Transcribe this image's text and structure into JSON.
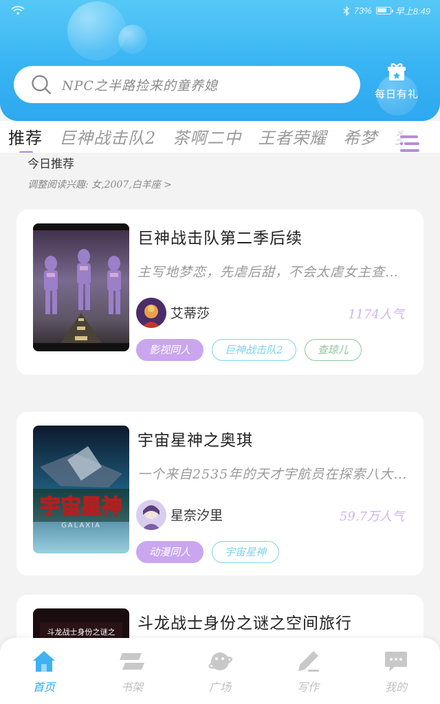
{
  "status_bar": {
    "battery_percent": "73%",
    "time": "早上8:49"
  },
  "search": {
    "placeholder": "NPC之半路捡来的童养媳"
  },
  "daily_gift": {
    "label": "每日有礼",
    "icon": "gift-icon"
  },
  "tabs": [
    {
      "label": "推荐",
      "active": true
    },
    {
      "label": "巨神战击队2",
      "active": false
    },
    {
      "label": "茶啊二中",
      "active": false
    },
    {
      "label": "王者荣耀",
      "active": false
    },
    {
      "label": "希梦",
      "active": false
    },
    {
      "label": "梦",
      "active": false
    }
  ],
  "section": {
    "title": "今日推荐",
    "interest_line": "调整阅读兴趣: 女,2007,白羊座 >"
  },
  "books": [
    {
      "title": "巨神战击队第二季后续",
      "description": "主写地梦恋，先虐后甜，不会太虐女主查…",
      "author": "艾蒂莎",
      "popularity": "1174人气",
      "tags": [
        {
          "label": "影视同人",
          "style": "filled",
          "color": "#c9a6ee"
        },
        {
          "label": "巨神战击队2",
          "style": "outline",
          "color": "#7fd3ea"
        },
        {
          "label": "查琼儿",
          "style": "outline",
          "color": "#8cc49a"
        }
      ]
    },
    {
      "title": "宇宙星神之奥琪",
      "description": "一个来自2535年的天才宇航员在探索八大…",
      "author": "星奈汐里",
      "popularity": "59.7万人气",
      "cover_text": "宇宙星神",
      "cover_subtext": "GALAXIA",
      "tags": [
        {
          "label": "动漫同人",
          "style": "filled",
          "color": "#c9a6ee"
        },
        {
          "label": "宇宙星神",
          "style": "outline",
          "color": "#7fd3ea"
        }
      ]
    },
    {
      "title": "斗龙战士身份之谜之空间旅行",
      "cover_text": "斗龙战士身份之谜之"
    }
  ],
  "bottom_nav": [
    {
      "label": "首页",
      "icon": "home-icon",
      "active": true
    },
    {
      "label": "书架",
      "icon": "bookshelf-icon",
      "active": false
    },
    {
      "label": "广场",
      "icon": "planet-icon",
      "active": false
    },
    {
      "label": "写作",
      "icon": "pen-icon",
      "active": false
    },
    {
      "label": "我的",
      "icon": "chat-icon",
      "active": false
    }
  ],
  "colors": {
    "header_blue": "#38b3f3",
    "accent_purple": "#a58bd8",
    "popularity_purple": "#cdb5ef",
    "nav_active": "#2fa9ef"
  }
}
